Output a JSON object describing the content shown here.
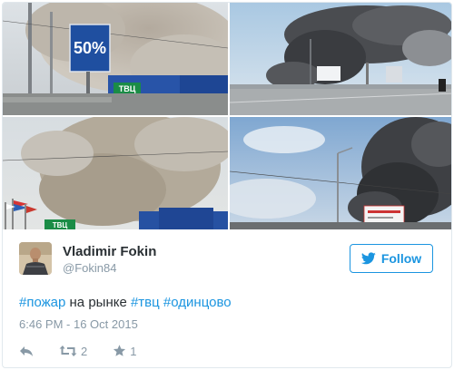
{
  "tweet": {
    "author": {
      "display_name": "Vladimir Fokin",
      "handle": "@Fokin84",
      "avatar_icon": "user-photo-avatar"
    },
    "follow_button": {
      "label": "Follow",
      "icon": "twitter-bird-icon",
      "color": "#1b95e0"
    },
    "text_parts": [
      {
        "kind": "hashtag",
        "text": "#пожар"
      },
      {
        "kind": "text",
        "text": " на рынке "
      },
      {
        "kind": "hashtag",
        "text": "#твц"
      },
      {
        "kind": "text",
        "text": " "
      },
      {
        "kind": "hashtag",
        "text": "#одинцово"
      }
    ],
    "timestamp": "6:46 PM - 16 Oct 2015",
    "actions": {
      "reply": {
        "icon": "reply-icon"
      },
      "retweet": {
        "icon": "retweet-icon",
        "count": "2"
      },
      "like": {
        "icon": "star-icon",
        "count": "1"
      }
    }
  },
  "photos": [
    {
      "name": "photo-billboard-smoke",
      "sign_text": "50%",
      "store_sign": "ТВЦ"
    },
    {
      "name": "photo-highway-smoke"
    },
    {
      "name": "photo-market-smoke",
      "store_sign": "ТВЦ"
    },
    {
      "name": "photo-roadside-smoke"
    }
  ],
  "colors": {
    "accent": "#1b95e0",
    "muted": "#8899a6",
    "text": "#292f33",
    "border": "#e1e8ed"
  }
}
